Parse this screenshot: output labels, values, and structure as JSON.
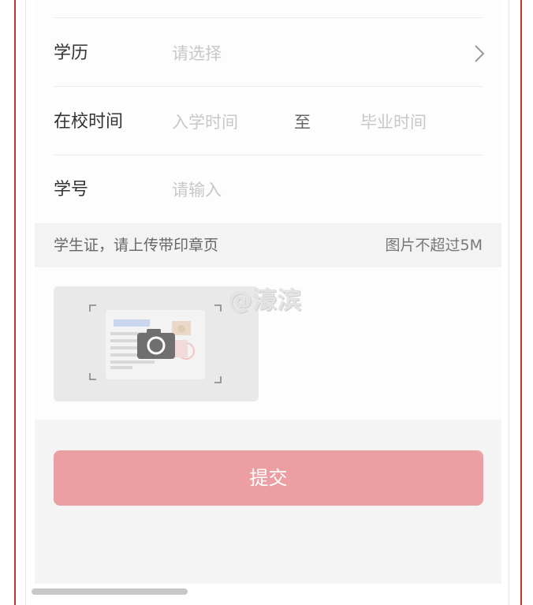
{
  "form": {
    "education": {
      "label": "学历",
      "placeholder": "请选择"
    },
    "school_time": {
      "label": "在校时间",
      "start_placeholder": "入学时间",
      "separator": "至",
      "end_placeholder": "毕业时间"
    },
    "student_id": {
      "label": "学号",
      "placeholder": "请输入"
    }
  },
  "upload_section": {
    "instruction": "学生证，请上传带印章页",
    "size_limit": "图片不超过5M",
    "icon": "camera-icon"
  },
  "watermark": "@濠滨",
  "submit_label": "提交",
  "colors": {
    "submit_bg": "#ec9fa2",
    "frame_border": "#c0392b",
    "placeholder": "#c8c8c8"
  }
}
